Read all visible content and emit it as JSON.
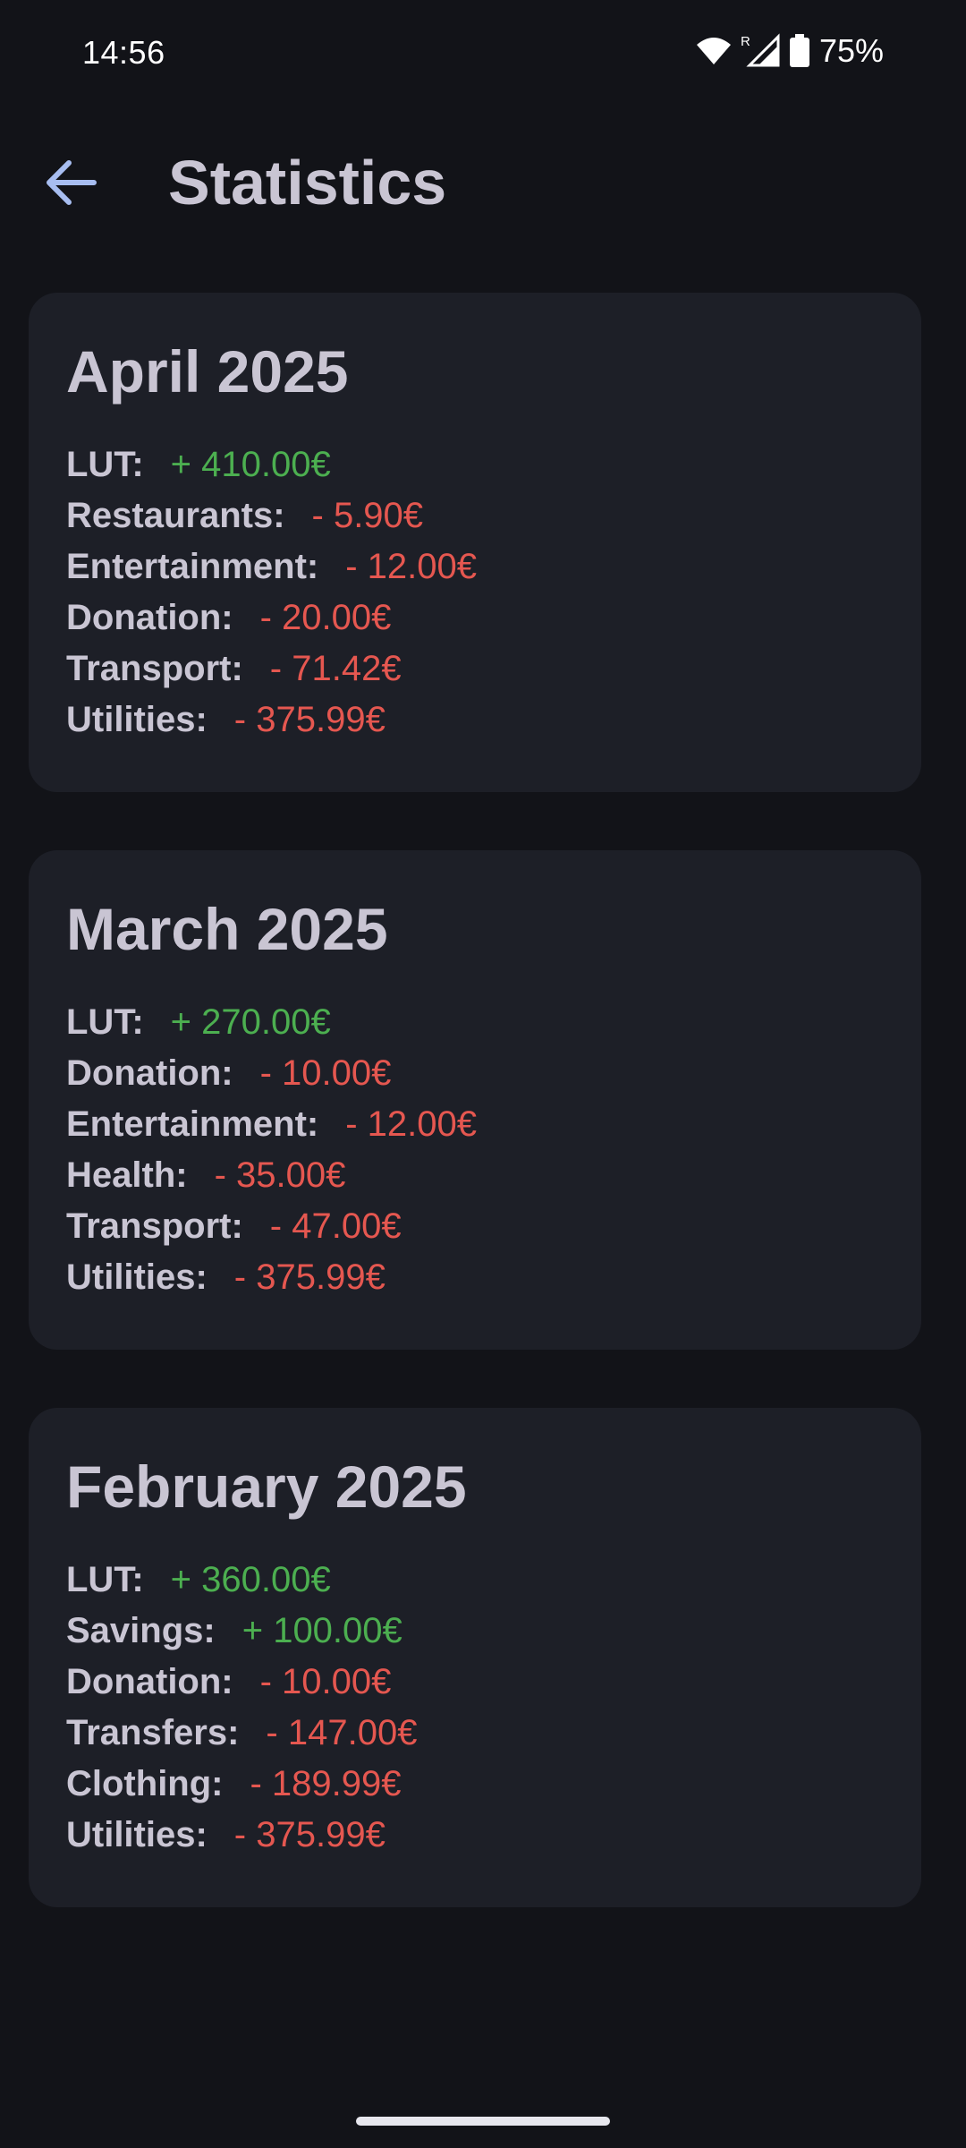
{
  "status_bar": {
    "time": "14:56",
    "roaming_indicator": "R",
    "battery_percent": "75%",
    "icons": [
      "wifi-icon",
      "cell-signal-icon",
      "battery-icon"
    ]
  },
  "app_bar": {
    "back_icon": "arrow-back-icon",
    "title": "Statistics"
  },
  "colors": {
    "background": "#121318",
    "card": "#1d1f27",
    "positive": "#4caf50",
    "negative": "#e55750",
    "accent": "#a7bdf0"
  },
  "months": [
    {
      "title": "April 2025",
      "entries": [
        {
          "label": "LUT:",
          "amount": "+ 410.00€",
          "sign": "pos"
        },
        {
          "label": "Restaurants:",
          "amount": "- 5.90€",
          "sign": "neg"
        },
        {
          "label": "Entertainment:",
          "amount": "- 12.00€",
          "sign": "neg"
        },
        {
          "label": "Donation:",
          "amount": "- 20.00€",
          "sign": "neg"
        },
        {
          "label": "Transport:",
          "amount": "- 71.42€",
          "sign": "neg"
        },
        {
          "label": "Utilities:",
          "amount": "- 375.99€",
          "sign": "neg"
        }
      ]
    },
    {
      "title": "March 2025",
      "entries": [
        {
          "label": "LUT:",
          "amount": "+ 270.00€",
          "sign": "pos"
        },
        {
          "label": "Donation:",
          "amount": "- 10.00€",
          "sign": "neg"
        },
        {
          "label": "Entertainment:",
          "amount": "- 12.00€",
          "sign": "neg"
        },
        {
          "label": "Health:",
          "amount": "- 35.00€",
          "sign": "neg"
        },
        {
          "label": "Transport:",
          "amount": "- 47.00€",
          "sign": "neg"
        },
        {
          "label": "Utilities:",
          "amount": "- 375.99€",
          "sign": "neg"
        }
      ]
    },
    {
      "title": "February 2025",
      "entries": [
        {
          "label": "LUT:",
          "amount": "+ 360.00€",
          "sign": "pos"
        },
        {
          "label": "Savings:",
          "amount": "+ 100.00€",
          "sign": "pos"
        },
        {
          "label": "Donation:",
          "amount": "- 10.00€",
          "sign": "neg"
        },
        {
          "label": "Transfers:",
          "amount": "- 147.00€",
          "sign": "neg"
        },
        {
          "label": "Clothing:",
          "amount": "- 189.99€",
          "sign": "neg"
        },
        {
          "label": "Utilities:",
          "amount": "- 375.99€",
          "sign": "neg"
        }
      ]
    }
  ]
}
